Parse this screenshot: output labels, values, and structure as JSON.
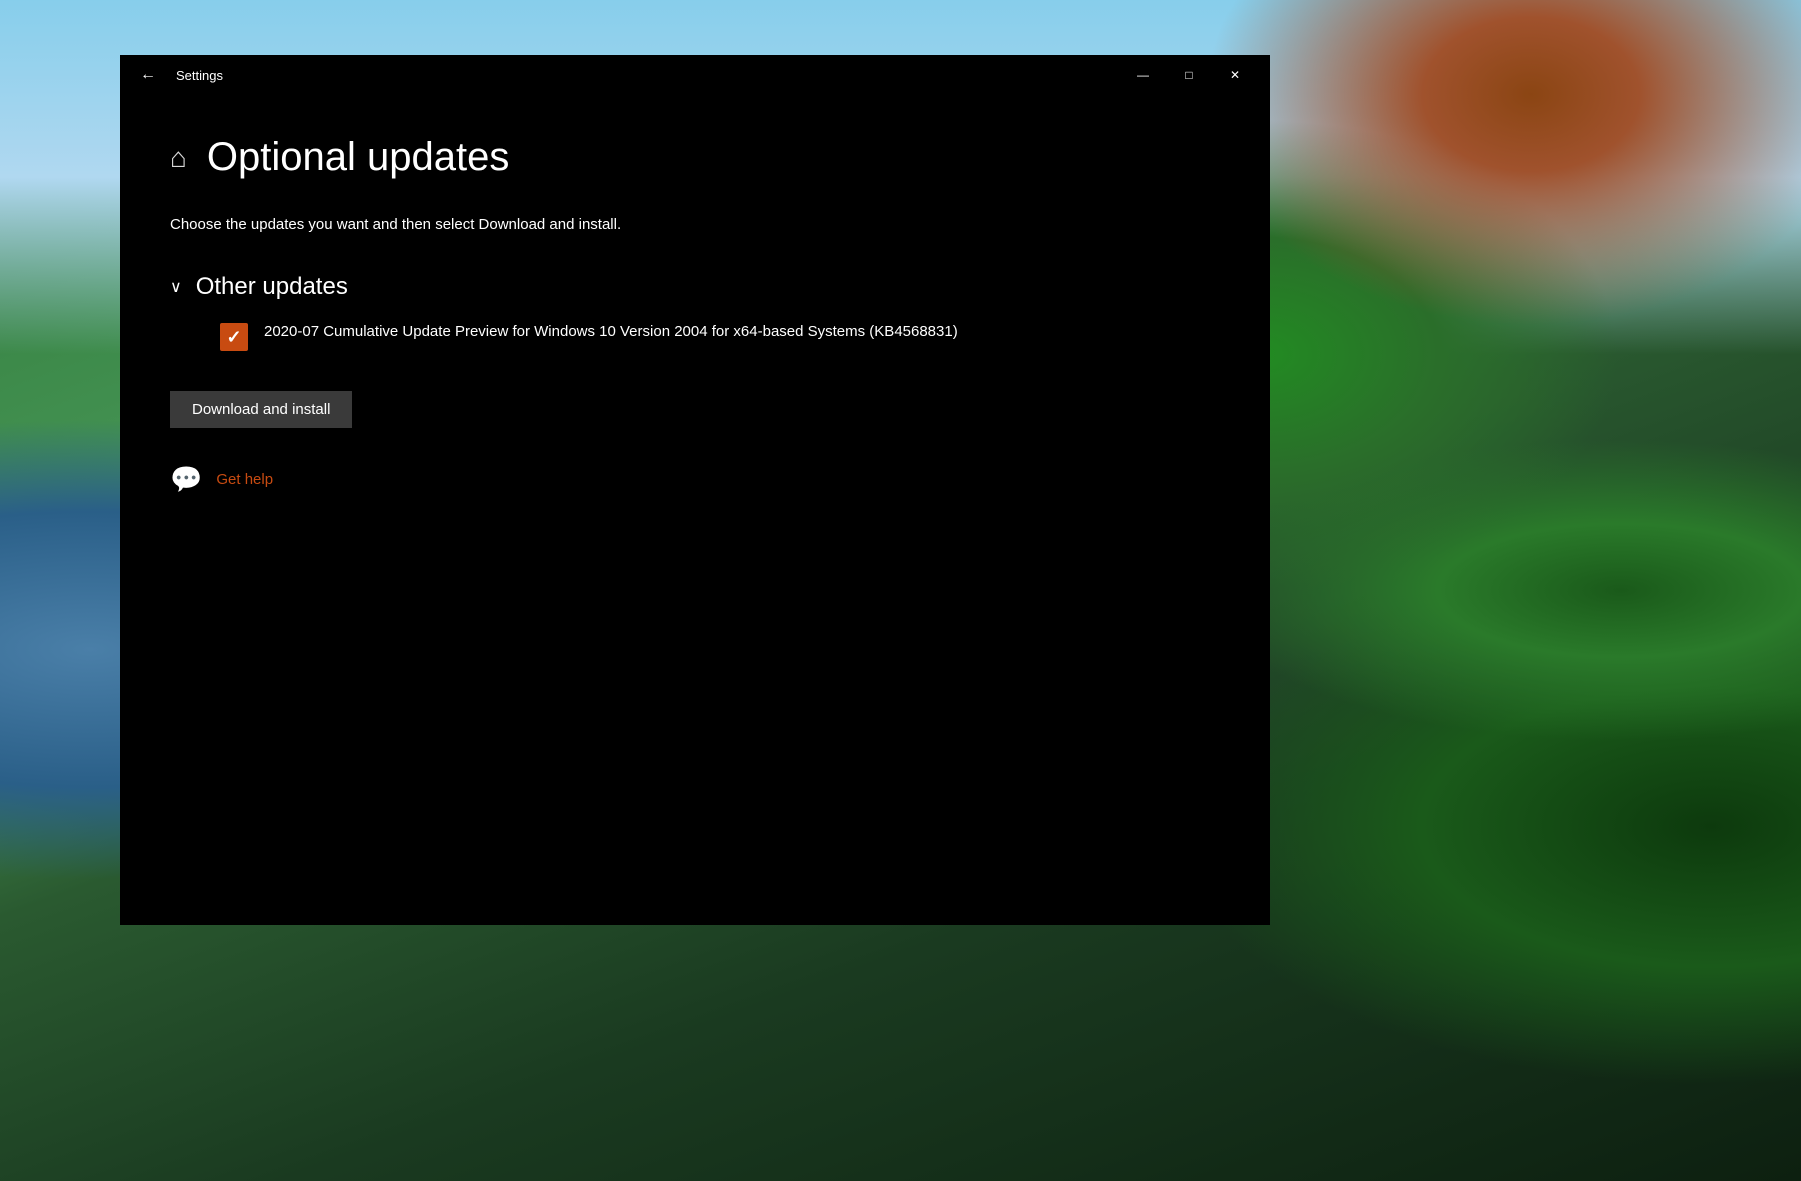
{
  "desktop": {
    "bg_description": "Windows 10 landscape wallpaper"
  },
  "window": {
    "title": "Settings",
    "titlebar": {
      "back_label": "←",
      "title": "Settings",
      "minimize_label": "—",
      "maximize_label": "□",
      "close_label": "✕"
    }
  },
  "page": {
    "home_icon": "⌂",
    "title": "Optional updates",
    "description": "Choose the updates you want and then select Download and install.",
    "section": {
      "chevron": "∨",
      "title": "Other updates",
      "update_item": {
        "checked": true,
        "text": "2020-07 Cumulative Update Preview for Windows 10 Version 2004 for x64-based Systems (KB4568831)"
      }
    },
    "download_button_label": "Download and install",
    "help": {
      "icon": "💬",
      "link_label": "Get help"
    }
  },
  "colors": {
    "bg": "#000000",
    "accent": "#c84b11",
    "text": "#ffffff",
    "button_bg": "#3a3a3a",
    "help_link": "#c84b11"
  }
}
